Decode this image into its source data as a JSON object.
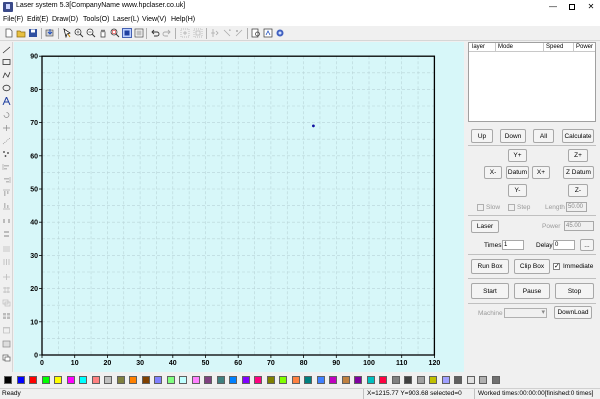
{
  "window": {
    "title": "Laser system 5.3[CompanyName www.hpclaser.co.uk]",
    "minimize": "—",
    "close": "✕"
  },
  "menu": [
    "File(F)",
    "Edit(E)",
    "Draw(D)",
    "Tools(O)",
    "Laser(L)",
    "View(V)",
    "Help(H)"
  ],
  "toolbar_icons": [
    "new-icon",
    "open-icon",
    "save-icon",
    "import-icon",
    "select-icon",
    "zoom-in-icon",
    "zoom-out-icon",
    "pan-icon",
    "zoom-window-icon",
    "zoom-all-icon",
    "fit-page-icon",
    "undo-icon",
    "redo-icon",
    "node-edit-icon",
    "group-icon",
    "ungroup-icon",
    "mirror-icon",
    "array-icon",
    "preview-icon",
    "simulate-icon",
    "settings-icon"
  ],
  "left_tools": [
    "line-icon",
    "rectangle-icon",
    "polyline-icon",
    "ellipse-icon",
    "text-icon",
    "rotate-icon",
    "scale-icon",
    "dotted-icon",
    "point-icon",
    "align-left-icon",
    "align-right-icon",
    "align-top-icon",
    "align-bottom-icon",
    "distribute-h-icon",
    "distribute-v-icon",
    "same-width-icon",
    "same-height-icon",
    "center-icon",
    "grid-icon",
    "layer-icon",
    "array-tool-icon",
    "delete-icon"
  ],
  "canvas": {
    "x_ticks": [
      "0",
      "10",
      "20",
      "30",
      "40",
      "50",
      "60",
      "70",
      "80",
      "90",
      "100",
      "110",
      "120"
    ],
    "y_ticks": [
      "0",
      "10",
      "20",
      "30",
      "40",
      "50",
      "60",
      "70",
      "80",
      "90"
    ],
    "point": {
      "x": 83,
      "y": 69
    }
  },
  "layer_table": {
    "headers": [
      "layer",
      "Mode",
      "Speed",
      "Power"
    ]
  },
  "panel": {
    "up": "Up",
    "down": "Down",
    "all": "All",
    "calculate": "Calculate",
    "y_plus": "Y+",
    "z_plus": "Z+",
    "x_minus": "X-",
    "datum": "Datum",
    "x_plus": "X+",
    "z_datum": "Z Datum",
    "y_minus": "Y-",
    "z_minus": "Z-",
    "slow": "Slow",
    "step": "Step",
    "length_label": "Length",
    "length_value": "50.00",
    "laser": "Laser",
    "power_label": "Power",
    "power_value": "45.00",
    "times_label": "Times",
    "times_value": "1",
    "delay_label": "Delay",
    "delay_value": "0",
    "ellipsis": "...",
    "run_box": "Run Box",
    "clip_box": "Clip Box",
    "immediate": "Immediate",
    "start": "Start",
    "pause": "Pause",
    "stop": "Stop",
    "machine_label": "Machine",
    "download": "DownLoad"
  },
  "palette": [
    "#000000",
    "#0000ff",
    "#ff0000",
    "#00ff00",
    "#ffff00",
    "#ff00ff",
    "#00ffff",
    "#ff8080",
    "#c0c0c0",
    "#808040",
    "#ff8000",
    "#804000",
    "#8080ff",
    "#80ff80",
    "#c0ffff",
    "#ff80ff",
    "#804080",
    "#408080",
    "#0080ff",
    "#8000ff",
    "#ff0080",
    "#808000",
    "#80ff00",
    "#ff8040",
    "#008080",
    "#4080ff",
    "#c000c0",
    "#c08040",
    "#8000a0",
    "#00c0c0",
    "#ff0040",
    "#808080",
    "#404040",
    "#a0a0a0",
    "#c0c000",
    "#a0a0ff",
    "#606060",
    "#e0e0e0",
    "#b0b0b0",
    "#707070"
  ],
  "status": {
    "ready": "Ready",
    "coords": "X=1215.77 Y=903.68 selected=0",
    "worked": "Worked times:00:00:00[finished:0 times]"
  }
}
